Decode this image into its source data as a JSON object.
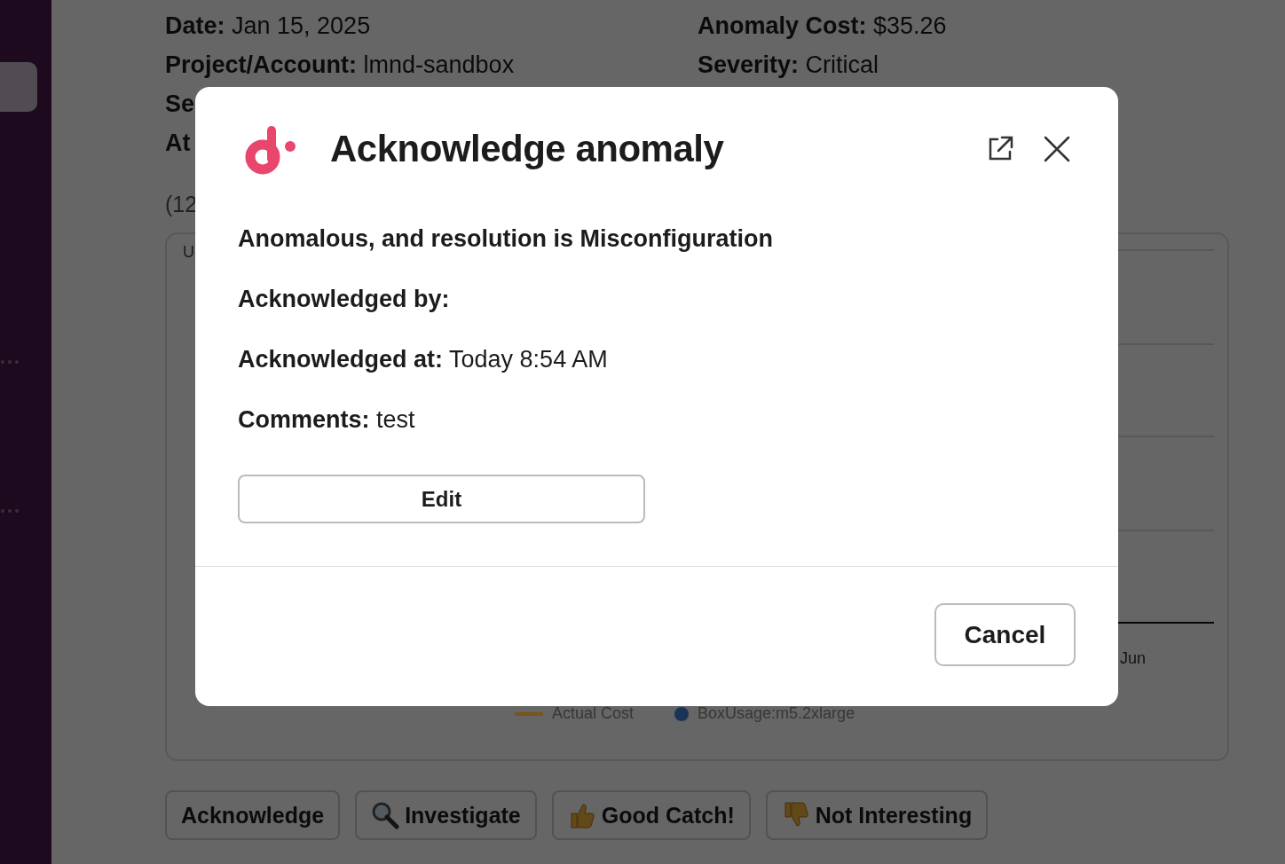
{
  "sidebar": {
    "items": [
      {
        "kind": "highlight"
      },
      {
        "kind": "more"
      },
      {
        "kind": "more"
      }
    ]
  },
  "message": {
    "fields": [
      {
        "label": "Date:",
        "value": "Jan 15, 2025"
      },
      {
        "label": "Anomaly Cost:",
        "value": "$35.26"
      },
      {
        "label": "Project/Account:",
        "value": "lmnd-sandbox"
      },
      {
        "label": "Severity:",
        "value": "Critical"
      },
      {
        "label": "Se"
      },
      {
        "label": "At"
      }
    ],
    "note": "(12",
    "chart": {
      "title": "U",
      "x_label": "Jun",
      "legend": [
        {
          "name": "Actual Cost",
          "kind": "line",
          "color": "#7a5418"
        },
        {
          "name": "BoxUsage:m5.2xlarge",
          "kind": "dot",
          "color": "#1c3358"
        }
      ]
    },
    "buttons": [
      {
        "label": "Acknowledge"
      },
      {
        "label": "Investigate",
        "kind": "search"
      },
      {
        "label": "Good Catch!",
        "kind": "thumbs-up"
      },
      {
        "label": "Not Interesting",
        "kind": "thumbs-down"
      }
    ]
  },
  "modal": {
    "title": "Acknowledge anomaly",
    "lines": [
      {
        "label": "Anomalous, and resolution is Misconfiguration"
      },
      {
        "label": "Acknowledged by:"
      },
      {
        "label": "Acknowledged at:",
        "value": "Today 8:54 AM"
      },
      {
        "label": "Comments:",
        "value": "test"
      }
    ],
    "edit_button": "Edit",
    "cancel_button": "Cancel"
  }
}
